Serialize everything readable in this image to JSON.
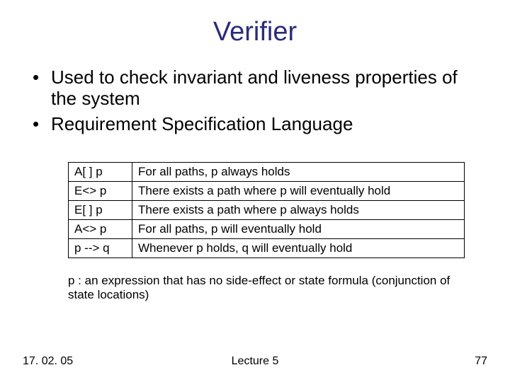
{
  "title": "Verifier",
  "bullets": [
    "Used to check invariant and liveness properties of the system",
    "Requirement Specification Language"
  ],
  "table": [
    {
      "op": "A[ ] p",
      "desc": "For all paths, p always holds"
    },
    {
      "op": "E<> p",
      "desc": "There exists a path where p will eventually hold"
    },
    {
      "op": "E[ ] p",
      "desc": "There exists a path where p always holds"
    },
    {
      "op": "A<> p",
      "desc": "For all paths, p will eventually hold"
    },
    {
      "op": "p --> q",
      "desc": "Whenever p holds, q will eventually hold"
    }
  ],
  "note": "p : an expression that has no side-effect or state formula (conjunction of state locations)",
  "footer": {
    "left": "17. 02. 05",
    "center": "Lecture 5",
    "right": "77"
  }
}
